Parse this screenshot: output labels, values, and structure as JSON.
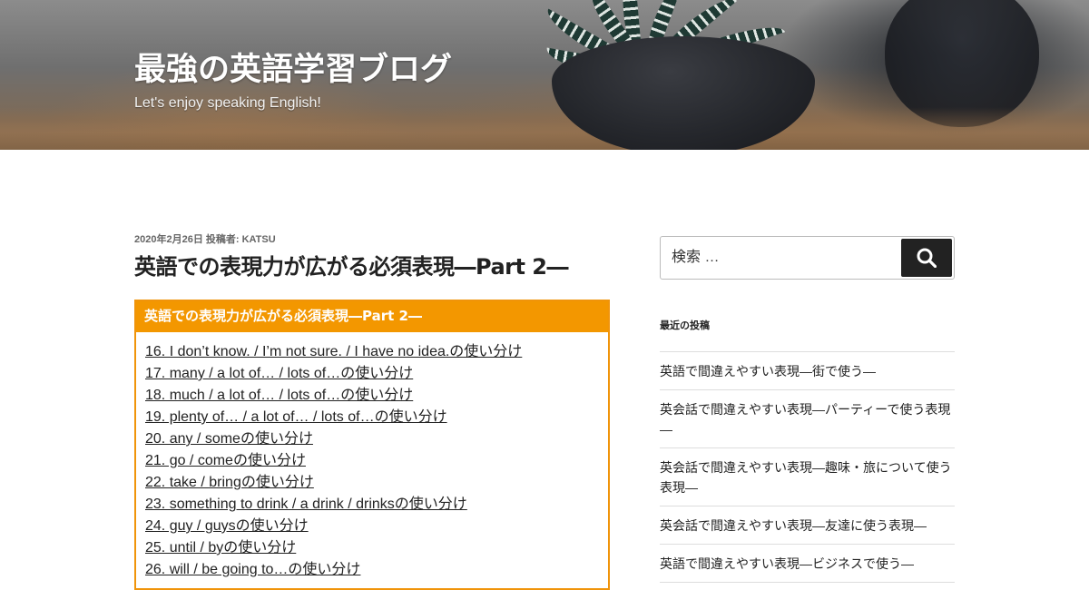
{
  "header": {
    "site_title": "最強の英語学習ブログ",
    "site_description": "Let's enjoy speaking English!"
  },
  "post": {
    "meta": "2020年2月26日 投稿者: KATSU",
    "title": "英語での表現力が広がる必須表現―Part 2―"
  },
  "toc": {
    "heading": "英語での表現力が広がる必須表現―Part 2―",
    "items": [
      "16. I don’t know. / I’m not sure. / I have no idea.の使い分け",
      "17. many / a lot of… / lots of…の使い分け",
      "18. much / a lot of… / lots of…の使い分け",
      "19. plenty of… / a lot of… / lots of…の使い分け",
      "20. any / someの使い分け",
      "21. go / comeの使い分け",
      "22. take / bringの使い分け",
      "23. something to drink / a drink / drinksの使い分け",
      "24. guy / guysの使い分け",
      "25. until / byの使い分け",
      "26. will / be going to…の使い分け"
    ]
  },
  "sidebar": {
    "search": {
      "placeholder": "検索 …",
      "icon": "search-icon"
    },
    "recent_title": "最近の投稿",
    "recent_posts": [
      "英語で間違えやすい表現―街で使う―",
      "英会話で間違えやすい表現―パーティーで使う表現―",
      "英会話で間違えやすい表現―趣味・旅について使う表現―",
      "英会話で間違えやすい表現―友達に使う表現―",
      "英語で間違えやすい表現―ビジネスで使う―"
    ]
  },
  "colors": {
    "accent": "#f39700",
    "button": "#222222"
  }
}
